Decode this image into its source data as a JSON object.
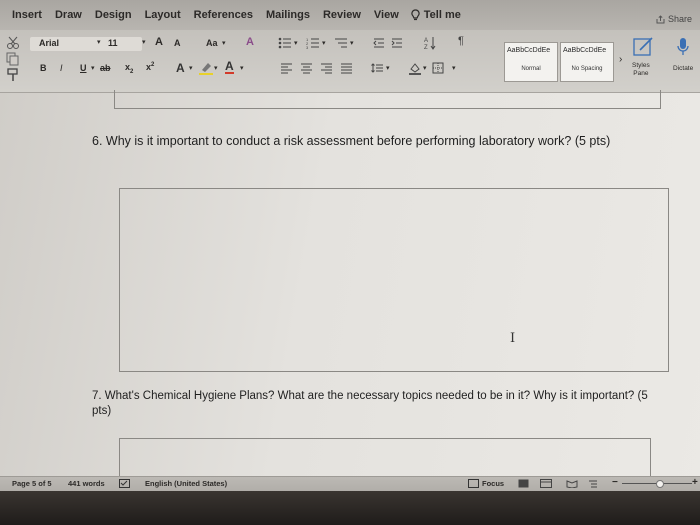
{
  "ribbon_tabs": [
    "Insert",
    "Draw",
    "Design",
    "Layout",
    "References",
    "Mailings",
    "Review",
    "View"
  ],
  "tell_me": "Tell me",
  "share": "Share",
  "font": {
    "name": "Arial",
    "size": "11",
    "grow": "A",
    "shrink": "A",
    "case": "Aa",
    "clear_format": "A"
  },
  "format_buttons": {
    "bold": "B",
    "italic": "I",
    "underline": "U",
    "strike": "ab",
    "subscript": "x",
    "superscript": "x"
  },
  "styles": [
    {
      "sample": "AaBbCcDdEe",
      "name": "Normal"
    },
    {
      "sample": "AaBbCcDdEe",
      "name": "No Spacing"
    }
  ],
  "styles_pane": "Styles\nPane",
  "dictate": "Dictate",
  "document": {
    "question6": "6.  Why is it important to conduct a risk assessment before performing laboratory work? (5 pts)",
    "question7": "7. What's Chemical Hygiene Plans? What are the necessary topics needed to be in it? Why is it important? (5 pts)",
    "cursor_glyph": "I"
  },
  "status_bar": {
    "page": "Page 5 of 5",
    "words": "441 words",
    "language": "English (United States)",
    "focus": "Focus"
  },
  "colors": {
    "ribbon": "#c4c1bc",
    "document": "#e6e4e0",
    "highlight_yellow": "#e8d12a",
    "font_red": "#d23a2a"
  }
}
